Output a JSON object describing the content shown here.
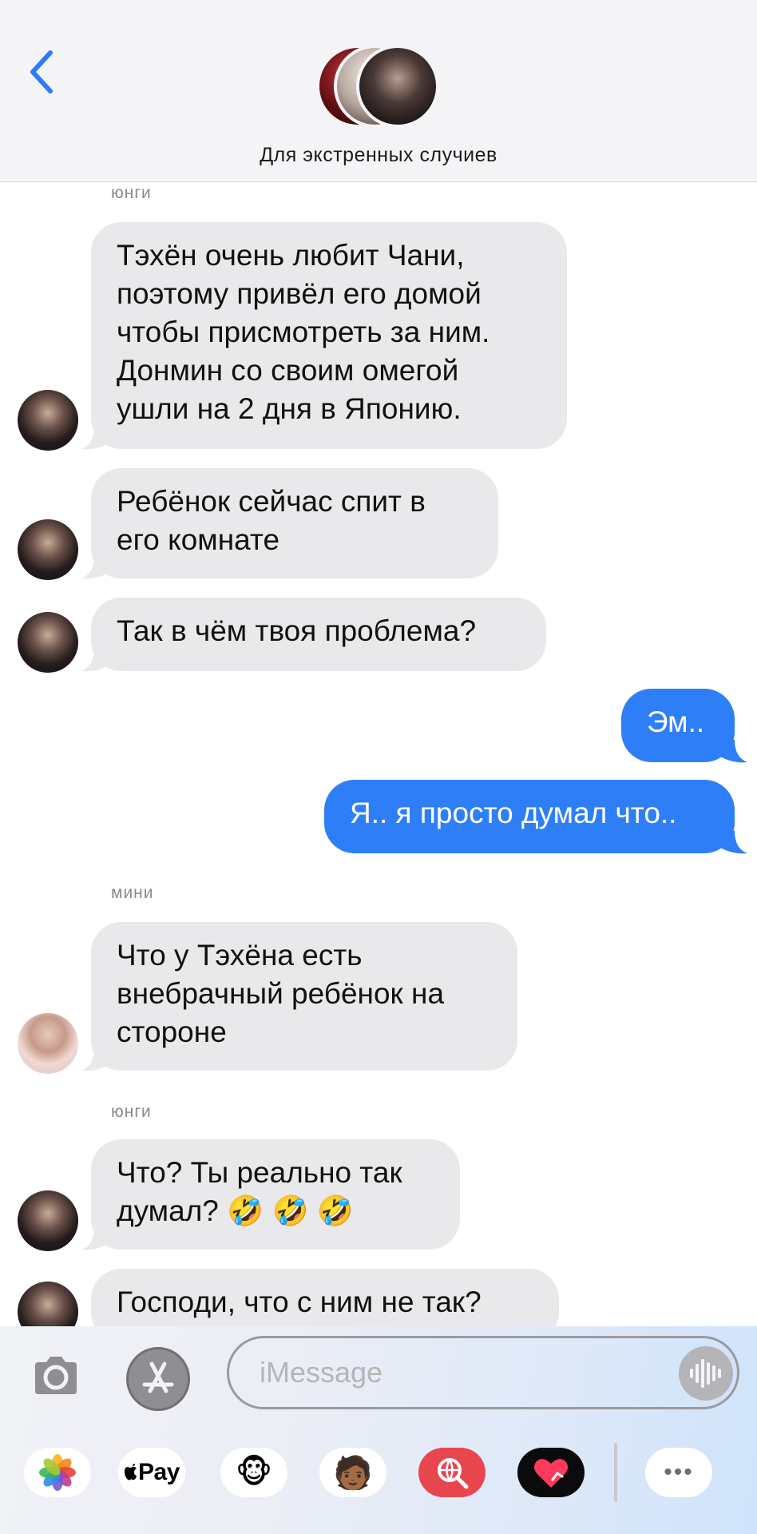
{
  "header": {
    "title": "Для экстренных случиев"
  },
  "messages": [
    {
      "sender": "юнги"
    },
    {
      "lines": [
        "Тэхён очень любит Чани,",
        "поэтому привёл его домой",
        "чтобы присмотреть за ним.",
        "Донмин со своим омегой",
        "ушли на 2 дня в Японию."
      ]
    },
    {
      "lines": [
        "Ребёнок сейчас спит в",
        "его комнате"
      ]
    },
    {
      "lines": [
        "Так в чём твоя проблема?"
      ]
    },
    {
      "lines": [
        "Эм.."
      ]
    },
    {
      "lines": [
        "Я.. я просто думал что.."
      ]
    },
    {
      "sender": "мини"
    },
    {
      "lines": [
        "Что у Тэхёна есть",
        "внебрачный ребёнок на",
        "стороне"
      ]
    },
    {
      "sender": "юнги"
    },
    {
      "lines": [
        "Что? Ты реально так",
        "думал? 🤣 🤣 🤣"
      ]
    },
    {
      "lines": [
        "Господи, что с ним не так?"
      ]
    }
  ],
  "composer": {
    "placeholder": "iMessage",
    "icons": [
      "camera-icon",
      "app-store-icon",
      "voice-waveform-icon"
    ]
  },
  "apps": [
    {
      "name": "photos-icon"
    },
    {
      "name": "apple-pay-icon",
      "label": "Pay"
    },
    {
      "name": "monkey-animoji-icon",
      "glyph": "🐵"
    },
    {
      "name": "memoji-icon",
      "glyph": "🧑🏾"
    },
    {
      "name": "web-search-icon"
    },
    {
      "name": "digital-touch-heart-icon"
    },
    {
      "name": "more-icon",
      "glyph": "•••"
    }
  ],
  "colors": {
    "outgoing_bubble": "#2e7ff7",
    "incoming_bubble": "#e9e9eb",
    "accent": "#2f7cf6"
  }
}
